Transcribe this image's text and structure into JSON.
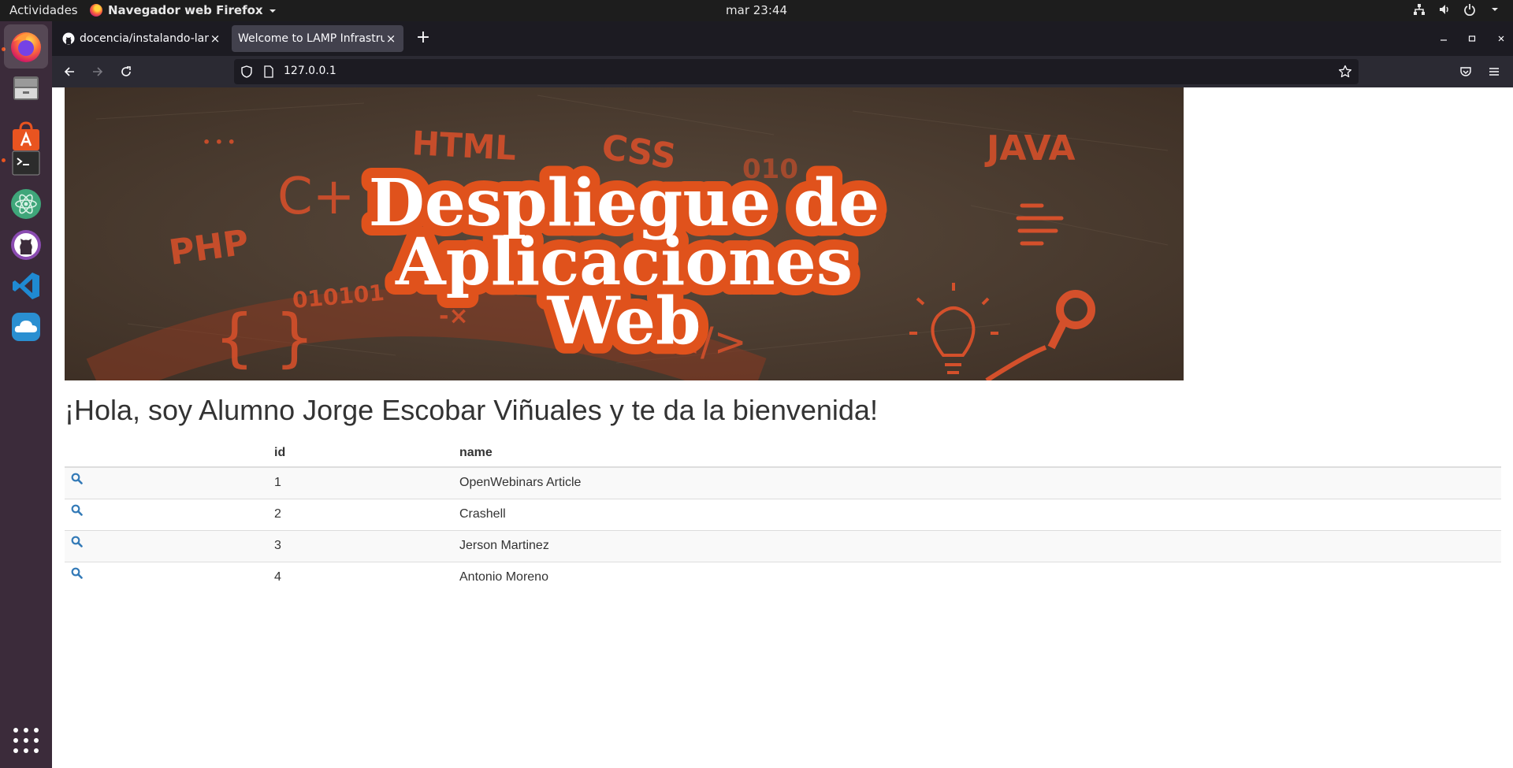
{
  "system": {
    "activities_label": "Actividades",
    "app_name": "Navegador web Firefox",
    "clock": "mar 23:44"
  },
  "browser": {
    "tabs": [
      {
        "title": "docencia/instalando-lamp",
        "close": "×"
      },
      {
        "title": "Welcome to LAMP Infrastructure",
        "close": "×"
      }
    ],
    "new_tab": "+",
    "url": "127.0.0.1"
  },
  "banner": {
    "line1": "Despliegue de",
    "line2": "Aplicaciones",
    "line3": "Web",
    "doodles": {
      "html": "HTML",
      "css": "CSS",
      "java": "JAVA",
      "php": "PHP",
      "cplus": "C+",
      "binary": "010101",
      "braces": "{ }",
      "tag": "</>",
      "minus_x": "-×",
      "binary2": "010",
      "dots": "• • •"
    },
    "colors": {
      "board": "#4a3a2e",
      "chalk": "#d4502b",
      "title_fill": "#ffffff",
      "title_outline": "#e0521c"
    }
  },
  "greeting": "¡Hola, soy Alumno Jorge Escobar Viñuales y te da la bienvenida!",
  "table": {
    "headers": [
      "",
      "id",
      "name"
    ],
    "rows": [
      {
        "id": "1",
        "name": "OpenWebinars Article"
      },
      {
        "id": "2",
        "name": "Crashell"
      },
      {
        "id": "3",
        "name": "Jerson Martinez"
      },
      {
        "id": "4",
        "name": "Antonio Moreno"
      }
    ],
    "row_icon": "search-icon",
    "link_color": "#337ab7"
  },
  "dock": [
    "firefox",
    "files",
    "software",
    "terminal",
    "atom",
    "github-desktop",
    "vscode",
    "cloud",
    "show-apps"
  ]
}
